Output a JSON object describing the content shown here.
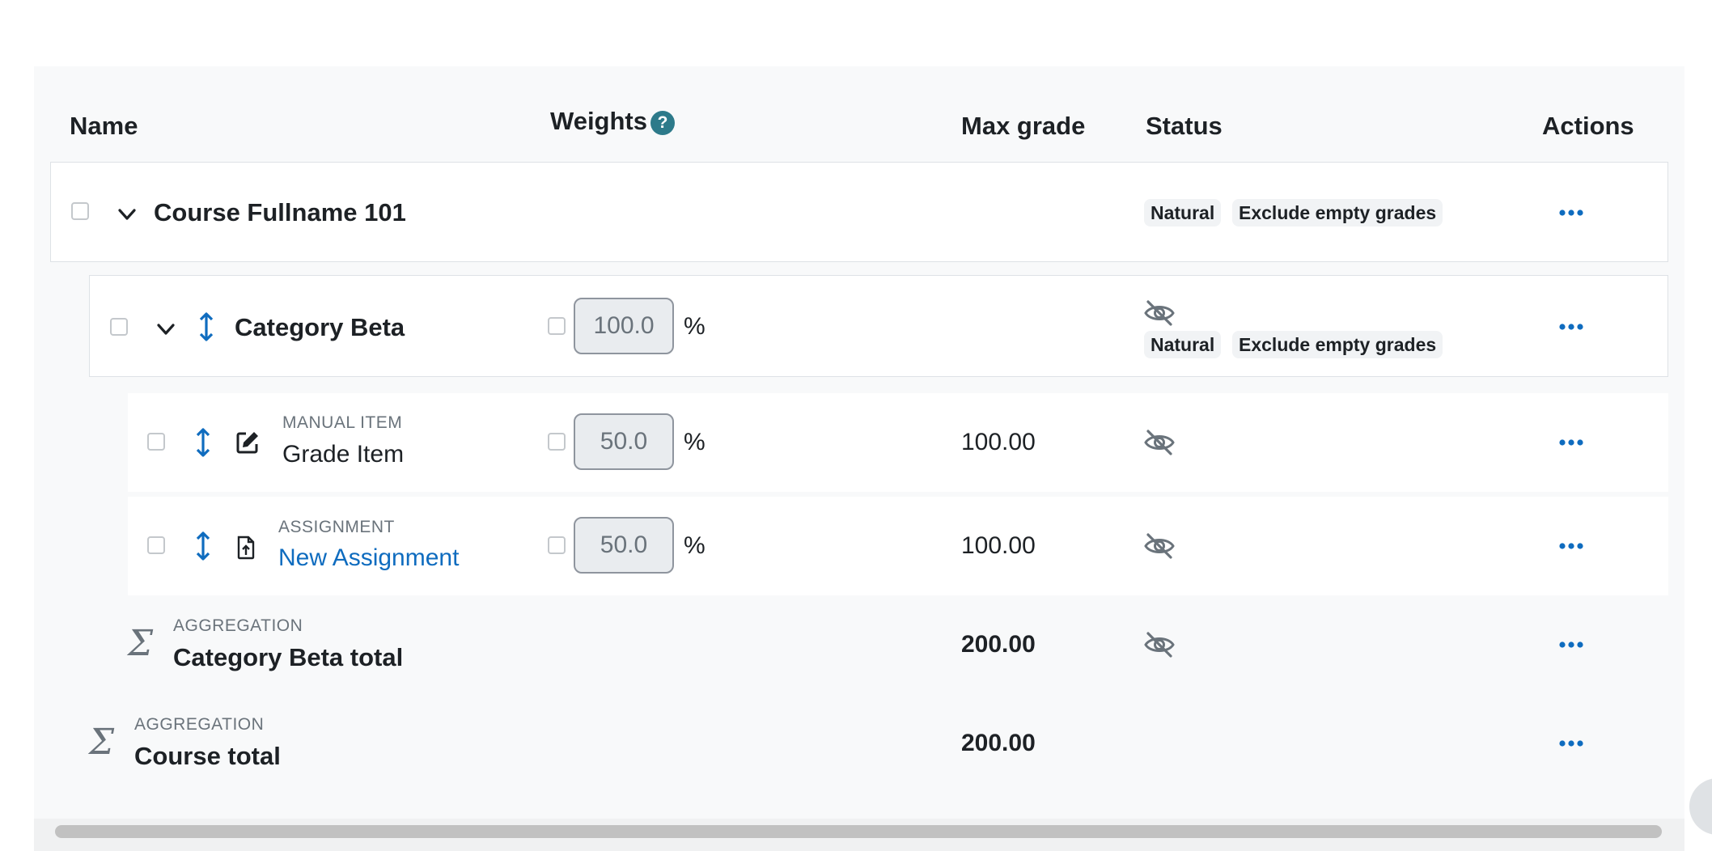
{
  "header": {
    "name": "Name",
    "weights": "Weights",
    "help_glyph": "?",
    "max_grade": "Max grade",
    "status": "Status",
    "actions": "Actions"
  },
  "rows": {
    "course": {
      "title": "Course Fullname 101",
      "badges": [
        "Natural",
        "Exclude empty grades"
      ]
    },
    "category": {
      "title": "Category Beta",
      "weight": "100.0",
      "weight_unit": "%",
      "badges": [
        "Natural",
        "Exclude empty grades"
      ]
    },
    "grade_item": {
      "kind": "MANUAL ITEM",
      "name": "Grade Item",
      "weight": "50.0",
      "weight_unit": "%",
      "max_grade": "100.00"
    },
    "assignment": {
      "kind": "ASSIGNMENT",
      "name": "New Assignment",
      "weight": "50.0",
      "weight_unit": "%",
      "max_grade": "100.00"
    },
    "category_total": {
      "kind": "AGGREGATION",
      "name": "Category Beta total",
      "max_grade": "200.00"
    },
    "course_total": {
      "kind": "AGGREGATION",
      "name": "Course total",
      "max_grade": "200.00"
    }
  },
  "icons": {
    "sigma_glyph": "Σ",
    "move": "move-arrows-icon",
    "hidden": "eye-slash-icon",
    "actions": "ellipsis-icon"
  },
  "colors": {
    "link": "#0f6cbf",
    "help_badge": "#2d7a8a",
    "panel_bg": "#f8f9fa"
  }
}
